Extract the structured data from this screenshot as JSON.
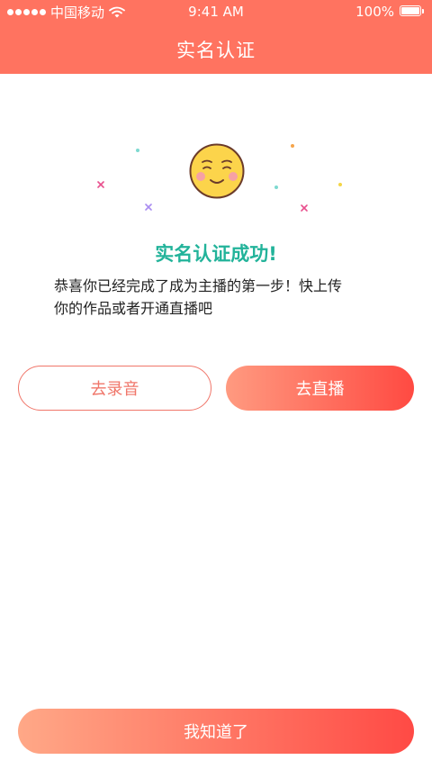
{
  "status_bar": {
    "carrier": "中国移动",
    "time": "9:41 AM",
    "battery": "100%",
    "battery_level": 1.0
  },
  "header": {
    "title": "实名认证"
  },
  "content": {
    "icon": "smiley-face-icon",
    "success_title": "实名认证成功!",
    "message_line1": "恭喜你已经完成了成为主播的第一步！快上传",
    "message_line2": "你的作品或者开通直播吧"
  },
  "actions": {
    "record_label": "去录音",
    "live_label": "去直播",
    "ok_label": "我知道了"
  },
  "colors": {
    "header_bg": "#FF7360",
    "success_text": "#22B39A",
    "accent": "#F0766A"
  }
}
